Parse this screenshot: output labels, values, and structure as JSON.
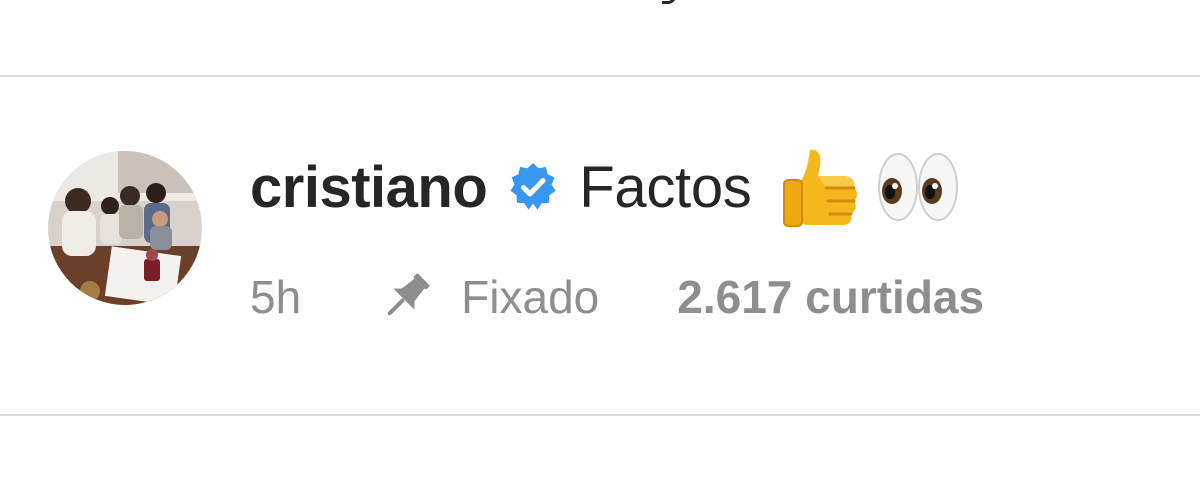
{
  "comment": {
    "username": "cristiano",
    "verified": true,
    "text": "Factos",
    "emojis": [
      "thumbs-up",
      "eyes"
    ],
    "timestamp": "5h",
    "pinned_label": "Fixado",
    "likes_label": "2.617 curtidas",
    "avatar": "profile-photo"
  },
  "colors": {
    "text_primary": "#262626",
    "text_secondary": "#8e8e8e",
    "verified_blue": "#3897f0",
    "divider": "#dbdbdb"
  }
}
